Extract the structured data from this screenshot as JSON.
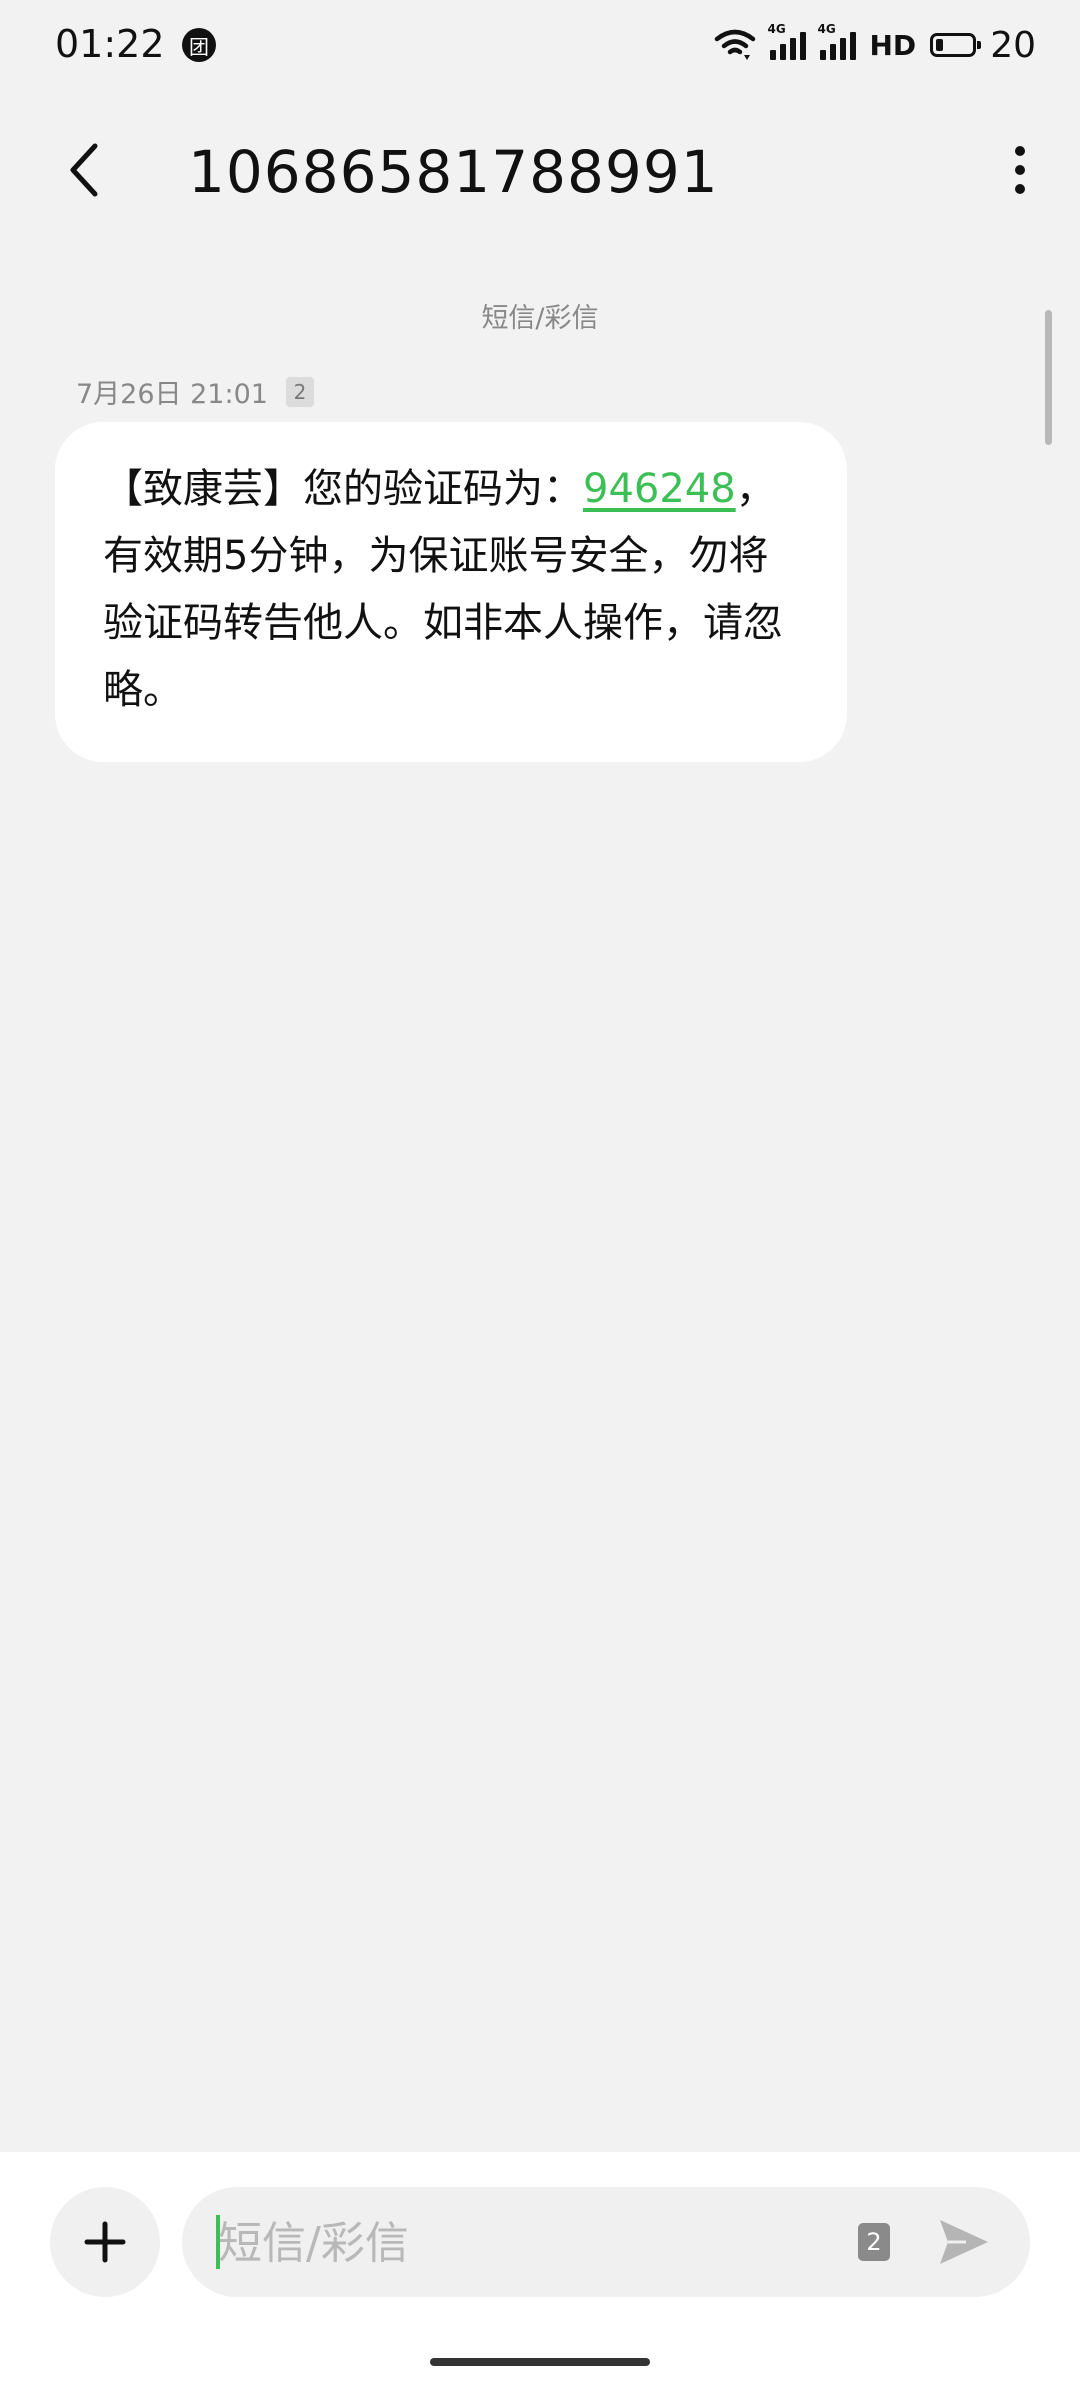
{
  "status_bar": {
    "time": "01:22",
    "app_icon_glyph": "团",
    "signal1_tag": "4G",
    "signal2_tag": "4G",
    "hd_label": "HD",
    "battery_level": "20",
    "battery_fraction": 0.2
  },
  "header": {
    "title": "10686581788991",
    "back_icon": "chevron-left-icon",
    "more_icon": "more-vertical-icon"
  },
  "conversation": {
    "channel_label": "短信/彩信",
    "messages": [
      {
        "time": "7月26日 21:01",
        "sim": "2",
        "text_before": "【致康芸】您的验证码为：",
        "code": "946248",
        "text_after": "，有效期5分钟，为保证账号安全，勿将验证码转告他人。如非本人操作，请忽略。"
      }
    ]
  },
  "compose": {
    "placeholder": "短信/彩信",
    "sim": "2",
    "add_icon": "plus-icon",
    "send_icon": "send-icon"
  },
  "colors": {
    "accent": "#3cbf55",
    "background": "#f2f2f2"
  }
}
